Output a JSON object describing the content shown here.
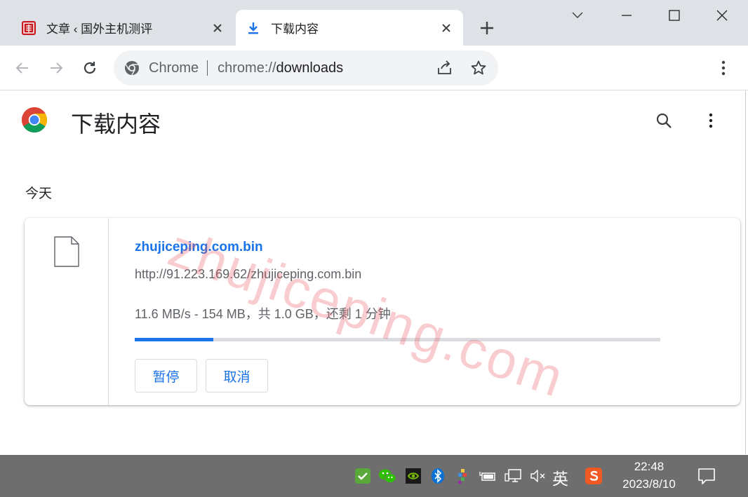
{
  "tabs": [
    {
      "title": "文章 ‹ 国外主机测评",
      "favicon": "site-seal-icon",
      "active": false
    },
    {
      "title": "下载内容",
      "favicon": "download-arrow-icon",
      "active": true
    }
  ],
  "toolbar": {
    "omnibox": {
      "chip": "Chrome",
      "url_scheme": "chrome://",
      "url_host": "downloads"
    }
  },
  "page": {
    "title": "下载内容",
    "section_label": "今天"
  },
  "download": {
    "file_name": "zhujiceping.com.bin",
    "url": "http://91.223.169.62/zhujiceping.com.bin",
    "status": "11.6 MB/s - 154 MB，共 1.0 GB，还剩 1 分钟",
    "progress_fraction": 0.15,
    "pause_label": "暂停",
    "cancel_label": "取消"
  },
  "watermark": "zhujiceping.com",
  "taskbar": {
    "ime": "英",
    "time": "22:48",
    "date": "2023/8/10"
  },
  "colors": {
    "accent": "#1a73e8",
    "tabstrip": "#dee1e6",
    "taskbar": "#6e6e6e"
  }
}
